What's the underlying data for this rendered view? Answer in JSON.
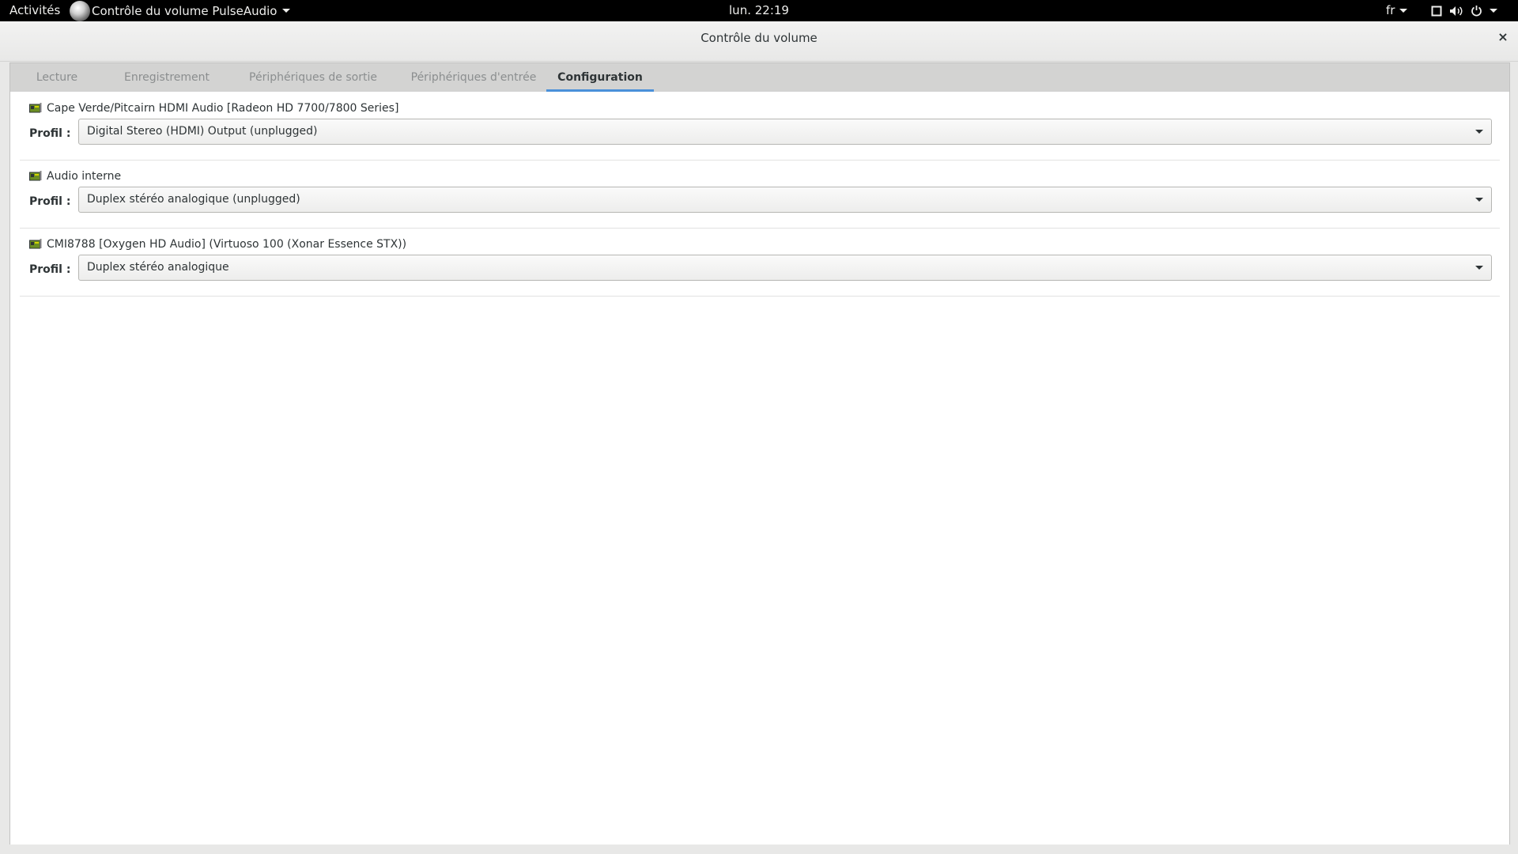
{
  "topbar": {
    "activities": "Activités",
    "app_menu": "Contrôle du volume PulseAudio",
    "clock": "lun. 22:19",
    "language": "fr"
  },
  "window": {
    "title": "Contrôle du volume",
    "close_label": "×"
  },
  "tabs": [
    {
      "label": "Lecture",
      "active": false
    },
    {
      "label": "Enregistrement",
      "active": false
    },
    {
      "label": "Périphériques de sortie",
      "active": false
    },
    {
      "label": "Périphériques d'entrée",
      "active": false
    },
    {
      "label": "Configuration",
      "active": true
    }
  ],
  "cards": [
    {
      "name": "Cape Verde/Pitcairn HDMI Audio [Radeon HD 7700/7800 Series]",
      "profile_label": "Profil :",
      "profile_value": "Digital Stereo (HDMI) Output (unplugged)",
      "icon": "audio-card-icon"
    },
    {
      "name": "Audio interne",
      "profile_label": "Profil :",
      "profile_value": "Duplex stéréo analogique (unplugged)",
      "icon": "audio-card-icon"
    },
    {
      "name": "CMI8788 [Oxygen HD Audio] (Virtuoso 100 (Xonar Essence STX))",
      "profile_label": "Profil :",
      "profile_value": "Duplex stéréo analogique",
      "icon": "audio-card-icon"
    }
  ],
  "colors": {
    "accent": "#4a90d9",
    "topbar_bg": "#000000",
    "text": "#2e3436",
    "inactive_tab_text": "#8b8e8f"
  }
}
